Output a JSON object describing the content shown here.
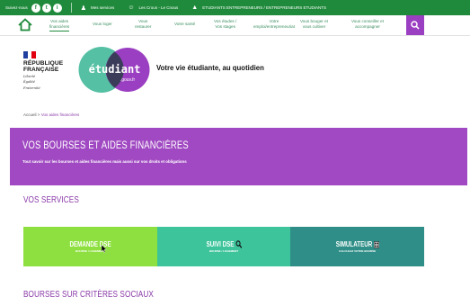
{
  "topbar": {
    "follow_label": "Suivez-nous",
    "social": [
      {
        "letter": "f",
        "icon": "facebook-icon"
      },
      {
        "letter": "t",
        "icon": "twitter-icon"
      },
      {
        "letter": "i",
        "icon": "instagram-icon"
      }
    ],
    "links": [
      {
        "label": "Mes services",
        "icon": "user-icon"
      },
      {
        "label": "Les Crous - Le Cnous",
        "icon": "group-icon"
      },
      {
        "label": "ETUDIANTS ENTREPRENEURS / ENTREPRENEURS ETUDIANTS",
        "icon": "building-icon"
      }
    ]
  },
  "nav": {
    "items": [
      {
        "label1": "Vos aides",
        "label2": "financières",
        "active": true
      },
      {
        "label1": "Vous loger",
        "label2": "",
        "active": false
      },
      {
        "label1": "Vous",
        "label2": "restaurer",
        "active": false
      },
      {
        "label1": "Votre santé",
        "label2": "",
        "active": false
      },
      {
        "label1": "Vos études /",
        "label2": "Vos stages",
        "active": false
      },
      {
        "label1": "Votre",
        "label2": "emploi/entrepreneuriat",
        "active": false
      },
      {
        "label1": "Vous bouger et",
        "label2": "vous cultiver",
        "active": false
      },
      {
        "label1": "Vous conseiller et",
        "label2": "accompagner",
        "active": false
      }
    ]
  },
  "branding": {
    "rf_line1": "RÉPUBLIQUE",
    "rf_line2": "FRANÇAISE",
    "motto1": "Liberté",
    "motto2": "Égalité",
    "motto3": "Fraternité",
    "logo_text": "étudiant",
    "logo_sub": ".gouv.fr",
    "tagline": "Votre vie étudiante, au quotidien"
  },
  "breadcrumb": {
    "home": "Accueil",
    "separator": ">",
    "current": "Vos aides financières"
  },
  "hero": {
    "title": "VOS BOURSES ET AIDES FINANCIÈRES",
    "subtitle": "Tout savoir sur les bourses et aides financières mais aussi sur vos droits et obligations"
  },
  "services_title": "VOS SERVICES",
  "services": [
    {
      "title": "DEMANDE DSE",
      "subtitle": "BOURSE / LOGEMENT",
      "color": "#8ee040",
      "icon": ""
    },
    {
      "title": "SUIVI DSE",
      "subtitle": "BOURSE / LOGEMENT",
      "color": "#3dc49a",
      "icon": "magnifier-icon"
    },
    {
      "title": "SIMULATEUR",
      "subtitle": "CALCULEZ VOTRE BOURSE",
      "color": "#2f8f88",
      "icon": "calculator-icon"
    }
  ],
  "bourses_title": "BOURSES SUR CRITÈRES SOCIAUX",
  "colors": {
    "topbar": "#1f8a3b",
    "accent_purple": "#a049c2",
    "nav_green": "#3b8f61"
  }
}
